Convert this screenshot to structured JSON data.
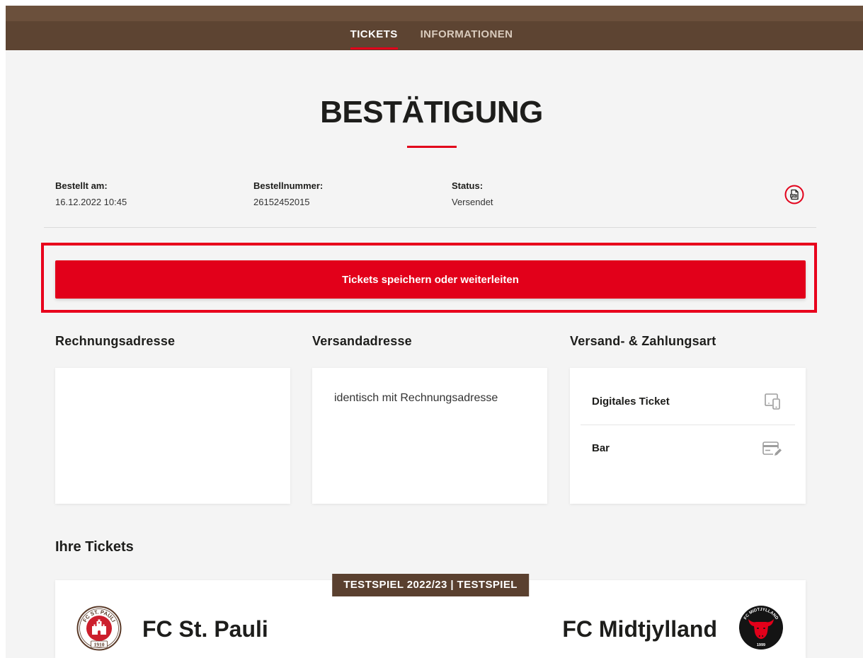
{
  "nav": {
    "tabs": [
      {
        "label": "TICKETS",
        "active": true
      },
      {
        "label": "INFORMATIONEN",
        "active": false
      }
    ]
  },
  "page": {
    "title": "BESTÄTIGUNG"
  },
  "order": {
    "ordered_at_label": "Bestellt am:",
    "ordered_at": "16.12.2022 10:45",
    "order_number_label": "Bestellnummer:",
    "order_number": "26152452015",
    "status_label": "Status:",
    "status": "Versendet",
    "pdf_label": "PDF",
    "pdf_icon": "pdf-download-icon"
  },
  "actions": {
    "save_forward_label": "Tickets speichern oder weiterleiten"
  },
  "addresses": {
    "billing_heading": "Rechnungsadresse",
    "shipping_heading": "Versandadresse",
    "shipping_text": "identisch mit Rechnungsadresse",
    "delivery_payment_heading": "Versand- & Zahlungsart",
    "delivery_payment_items": [
      {
        "label": "Digitales Ticket",
        "icon": "mobile-device-icon"
      },
      {
        "label": "Bar",
        "icon": "payment-card-icon"
      }
    ]
  },
  "tickets": {
    "heading": "Ihre Tickets",
    "match": {
      "badge": "TESTSPIEL 2022/23 | TESTSPIEL",
      "home_team": {
        "name": "FC St. Pauli",
        "logo_arc_text": "FC ST. PAULI",
        "logo_year": "1910"
      },
      "away_team": {
        "name": "FC Midtjylland",
        "logo_arc_text": "FC MIDTJYLLAND",
        "logo_year": "1999"
      }
    }
  },
  "colors": {
    "accent": "#e2001a",
    "brand_brown": "#5d4432",
    "page_background": "#f4f4f4"
  }
}
